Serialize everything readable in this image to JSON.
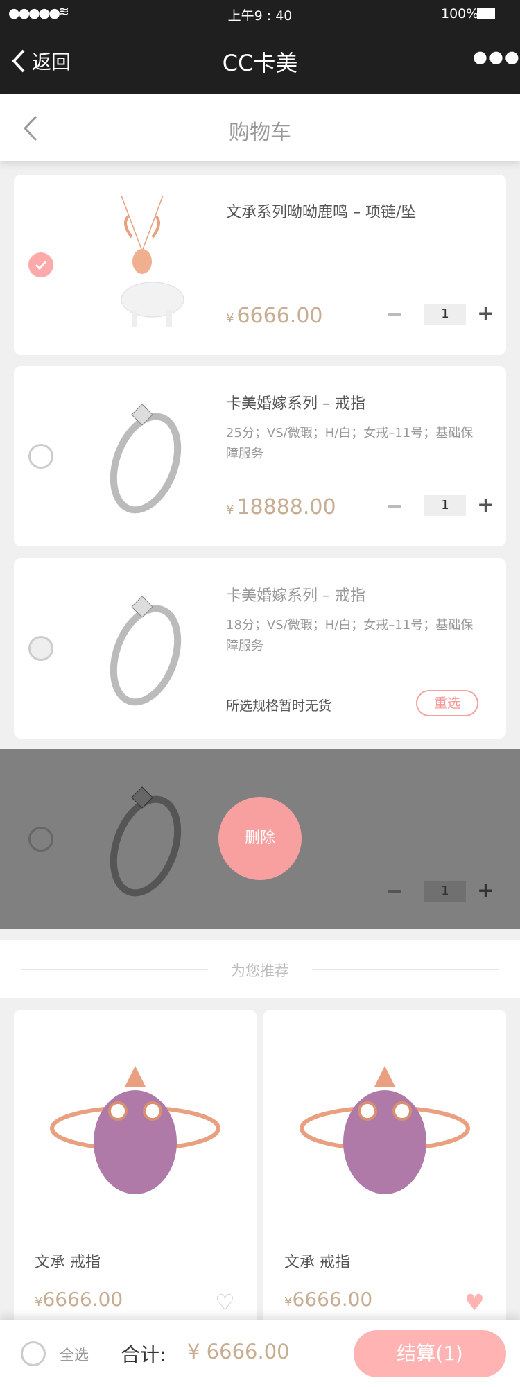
{
  "status": {
    "time": "上午9 : 40",
    "battery": "100%"
  },
  "nav": {
    "back": "返回",
    "title": "CC卡美"
  },
  "header": {
    "title": "购物车"
  },
  "cart": [
    {
      "title": "文承系列呦呦鹿鸣 – 项链/坠",
      "spec": "",
      "currency": "¥",
      "price": "6666.00",
      "qty": "1",
      "checked": true
    },
    {
      "title": "卡美婚嫁系列 – 戒指",
      "spec": "25分；VS/微瑕；H/白；女戒–11号；基础保障服务",
      "currency": "¥",
      "price": "18888.00",
      "qty": "1",
      "checked": false
    },
    {
      "title": "卡美婚嫁系列 – 戒指",
      "spec": "18分；VS/微瑕；H/白；女戒–11号；基础保障服务",
      "out_of_stock": "所选规格暂时无货",
      "reselect": "重选",
      "checked": false
    },
    {
      "qty": "1",
      "delete": "删除",
      "checked": false
    }
  ],
  "recommend": {
    "heading": "为您推荐",
    "items": [
      {
        "name": "文承  戒指",
        "currency": "¥",
        "price": "6666.00",
        "favorited": false
      },
      {
        "name": "文承  戒指",
        "currency": "¥",
        "price": "6666.00",
        "favorited": true
      }
    ]
  },
  "footer": {
    "select_all": "全选",
    "total_label": "合计:",
    "total": "¥ 6666.00",
    "checkout": "结算(1)"
  },
  "colors": {
    "accent": "#ffb3b3",
    "price": "#c9ad92",
    "nav": "#1f1f1f"
  }
}
